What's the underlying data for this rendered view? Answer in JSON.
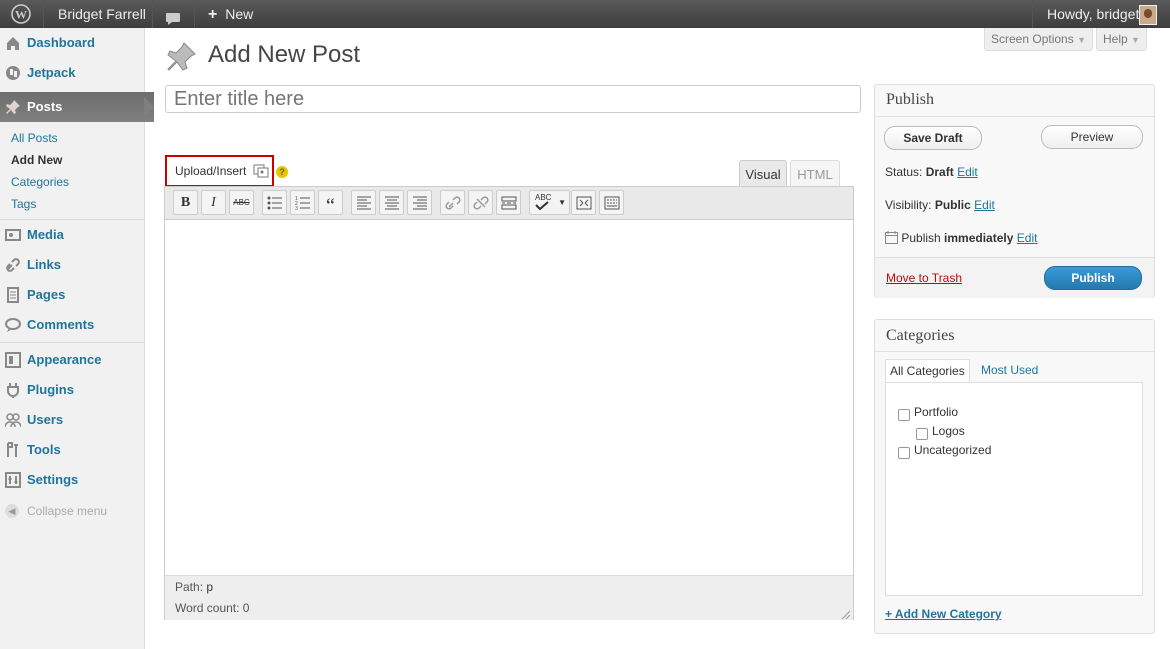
{
  "adminbar": {
    "site_name": "Bridget Farrell",
    "new_label": "New",
    "howdy": "Howdy, bridget"
  },
  "sidebar": {
    "items": [
      {
        "label": "Dashboard"
      },
      {
        "label": "Jetpack"
      },
      {
        "label": "Posts"
      },
      {
        "label": "Media"
      },
      {
        "label": "Links"
      },
      {
        "label": "Pages"
      },
      {
        "label": "Comments"
      },
      {
        "label": "Appearance"
      },
      {
        "label": "Plugins"
      },
      {
        "label": "Users"
      },
      {
        "label": "Tools"
      },
      {
        "label": "Settings"
      }
    ],
    "posts_submenu": [
      "All Posts",
      "Add New",
      "Categories",
      "Tags"
    ],
    "collapse": "Collapse menu"
  },
  "screen_options": "Screen Options",
  "help": "Help",
  "page_title": "Add New Post",
  "title_placeholder": "Enter title here",
  "editor": {
    "upload_insert": "Upload/Insert",
    "tab_visual": "Visual",
    "tab_html": "HTML",
    "path_label": "Path:",
    "path_value": "p",
    "word_count": "Word count: 0"
  },
  "publish_box": {
    "title": "Publish",
    "save_draft": "Save Draft",
    "preview": "Preview",
    "status_label": "Status:",
    "status_value": "Draft",
    "visibility_label": "Visibility:",
    "visibility_value": "Public",
    "publish_label": "Publish",
    "publish_value": "immediately",
    "edit": "Edit",
    "move_to_trash": "Move to Trash",
    "publish_button": "Publish"
  },
  "categories_box": {
    "title": "Categories",
    "tab_all": "All Categories",
    "tab_most_used": "Most Used",
    "items": [
      "Portfolio",
      "Logos",
      "Uncategorized"
    ],
    "add_new": "+ Add New Category"
  },
  "colors": {
    "link": "#21759b",
    "publish_button": "#2e8ccd",
    "trash": "#bc0b0b",
    "adminbar": "#464646"
  }
}
